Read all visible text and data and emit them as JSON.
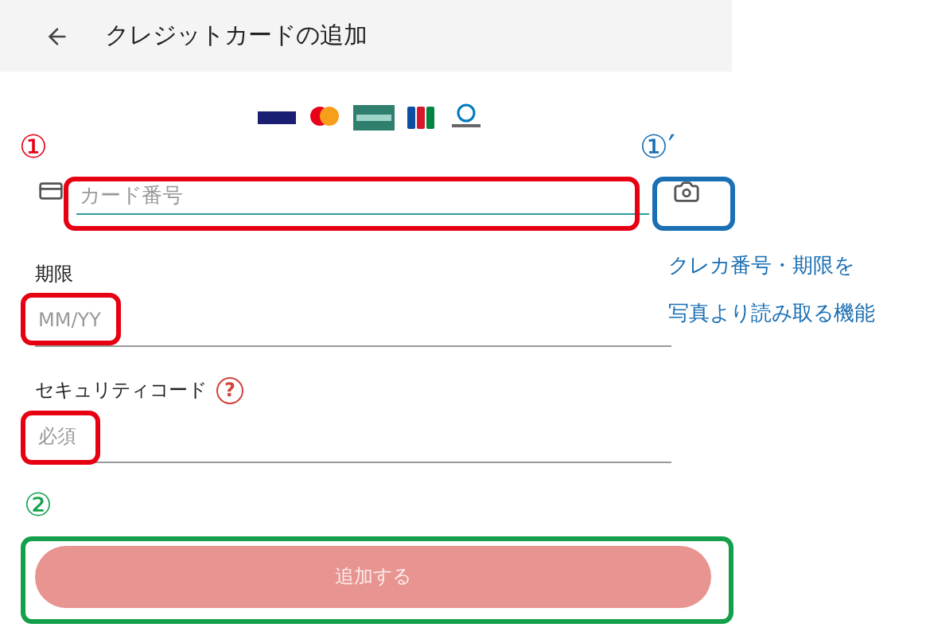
{
  "header": {
    "title": "クレジットカードの追加"
  },
  "fields": [
    {
      "kind": "card_number",
      "placeholder": "カード番号",
      "highlighted": true
    },
    {
      "kind": "expiry",
      "label": "期限",
      "placeholder": "MM/YY",
      "highlighted": true
    },
    {
      "kind": "security_code",
      "label": "セキュリティコード",
      "help": "?",
      "placeholder": "必須",
      "highlighted": true
    }
  ],
  "submit": {
    "label": "追加する",
    "disabled": true
  },
  "annotations": [
    {
      "marker": "①",
      "color": "#e60012"
    },
    {
      "marker": "①′",
      "color": "#1b6fb3",
      "note_lines": [
        "クレカ番号・期限を",
        "写真より読み取る機能"
      ]
    },
    {
      "marker": "②",
      "color": "#14a04a"
    }
  ]
}
